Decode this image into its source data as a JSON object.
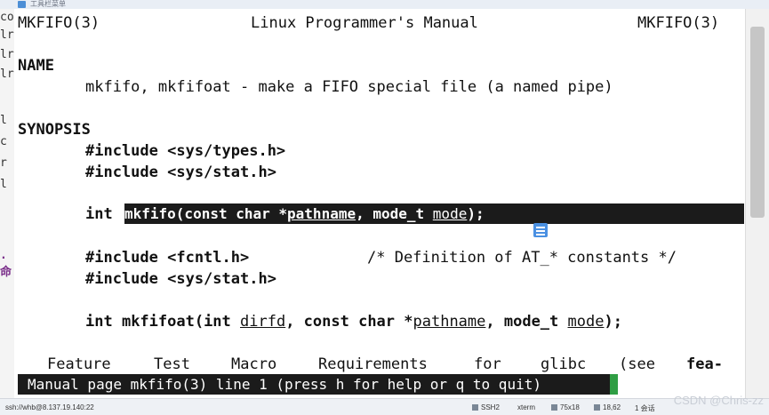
{
  "window": {
    "title": "工具栏菜单"
  },
  "left_strip_chars": [
    "co",
    "lr",
    "lr",
    "lr",
    "l",
    "c",
    "r",
    "l",
    ". 命"
  ],
  "manpage": {
    "header_left": "MKFIFO(3)",
    "header_center": "Linux Programmer's Manual",
    "header_right": "MKFIFO(3)",
    "name_heading": "NAME",
    "name_text": "mkfifo, mkfifoat - make a FIFO special file (a named pipe)",
    "synopsis_heading": "SYNOPSIS",
    "include1": "#include <sys/types.h>",
    "include2": "#include <sys/stat.h>",
    "proto1": {
      "ret": "int ",
      "fn": "mkfifo(const char *",
      "arg1": "pathname",
      "mid": ", mode_t ",
      "arg2": "mode",
      "end": ");"
    },
    "include3": "#include <fcntl.h>",
    "include3_comment": "/* Definition of AT_* constants */",
    "include4": "#include <sys/stat.h>",
    "proto2": {
      "ret": "int ",
      "fn": "mkfifoat(int ",
      "arg0": "dirfd",
      "sep": ", const char *",
      "arg1": "pathname",
      "mid": ", mode_t ",
      "arg2": "mode",
      "end": ");"
    },
    "feature_line": {
      "w1": "Feature",
      "w2": "Test",
      "w3": "Macro",
      "w4": "Requirements",
      "w5": "for",
      "w6": "glibc",
      "w7": "(see",
      "w8": "fea-"
    },
    "status": "Manual page mkfifo(3) line 1 (press h for help or q to quit)"
  },
  "statusbar": {
    "connection": "ssh://whb@8.137.19.140:22",
    "protocol": "SSH2",
    "term": "xterm",
    "size": "75x18",
    "cursor": "18,62",
    "sessions": "1 会话"
  },
  "watermark": "CSDN @Chris-zz",
  "colors": {
    "terminal_bg": "#ffffff",
    "terminal_fg": "#111111",
    "highlight_bg": "#1b1b1b",
    "cursor": "#2f9e44"
  }
}
